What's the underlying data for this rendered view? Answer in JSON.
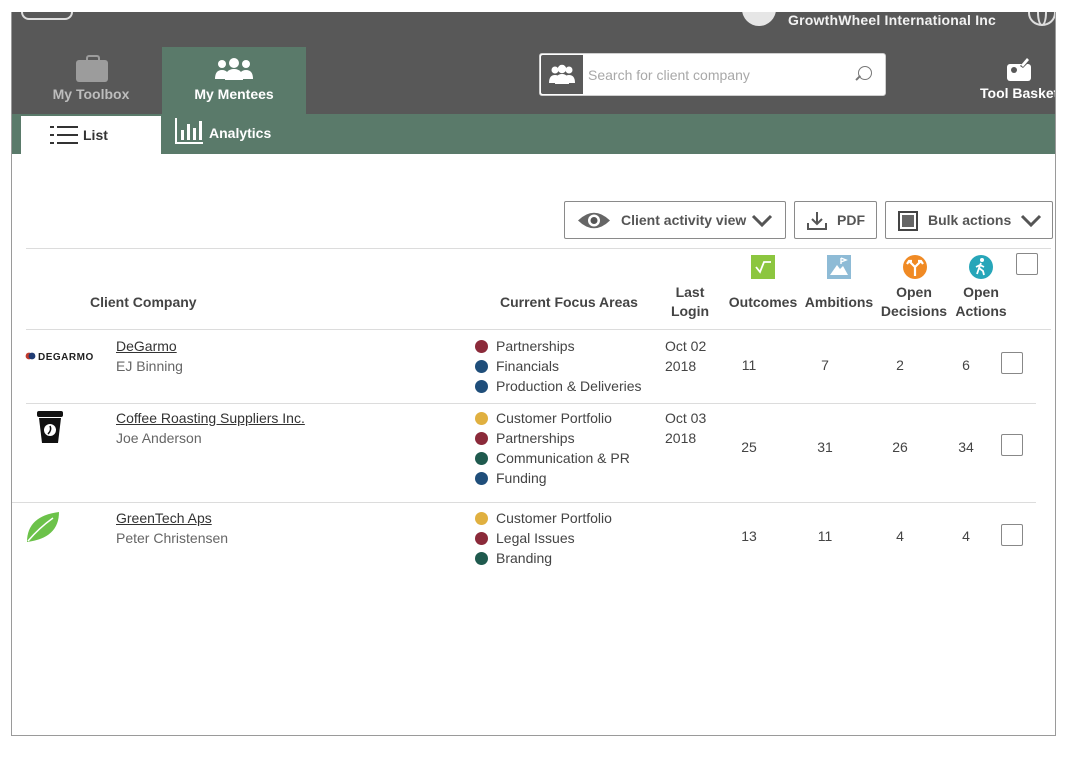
{
  "header": {
    "org_name": "GrowthWheel International Inc",
    "nav": [
      {
        "label": "My Toolbox",
        "icon": "toolbox-icon",
        "active": false
      },
      {
        "label": "My Mentees",
        "icon": "mentees-icon",
        "active": true
      }
    ],
    "search": {
      "placeholder": "Search for client company",
      "value": ""
    },
    "tool_basket_label": "Tool Basket"
  },
  "subnav": {
    "tabs": [
      {
        "label": "List",
        "icon": "list-icon",
        "active": true
      },
      {
        "label": "Analytics",
        "icon": "chart-icon",
        "active": false
      }
    ]
  },
  "toolbar": {
    "activity_view_label": "Client activity view",
    "pdf_label": "PDF",
    "bulk_actions_label": "Bulk actions"
  },
  "table": {
    "columns": {
      "company": "Client Company",
      "focus": "Current Focus Areas",
      "last_login": [
        "Last",
        "Login"
      ],
      "outcomes": "Outcomes",
      "ambitions": "Ambitions",
      "open_decisions": [
        "Open",
        "Decisions"
      ],
      "open_actions": [
        "Open",
        "Actions"
      ]
    },
    "rows": [
      {
        "logo_text": "DEGARMO",
        "company": "DeGarmo",
        "person": "EJ Binning",
        "focus": [
          {
            "label": "Partnerships",
            "color": "#8b2a3a"
          },
          {
            "label": "Financials",
            "color": "#1f4e7a"
          },
          {
            "label": "Production & Deliveries",
            "color": "#1f4e7a"
          }
        ],
        "last_login": [
          "Oct 02",
          "2018"
        ],
        "outcomes": "11",
        "ambitions": "7",
        "open_decisions": "2",
        "open_actions": "6"
      },
      {
        "logo_text": "",
        "company": "Coffee Roasting Suppliers Inc.",
        "person": "Joe Anderson",
        "focus": [
          {
            "label": "Customer Portfolio",
            "color": "#e0b040"
          },
          {
            "label": "Partnerships",
            "color": "#8b2a3a"
          },
          {
            "label": "Communication & PR",
            "color": "#1f5a4e"
          },
          {
            "label": "Funding",
            "color": "#1f4e7a"
          }
        ],
        "last_login": [
          "Oct 03",
          "2018"
        ],
        "outcomes": "25",
        "ambitions": "31",
        "open_decisions": "26",
        "open_actions": "34"
      },
      {
        "logo_text": "",
        "company": "GreenTech Aps",
        "person": "Peter Christensen",
        "focus": [
          {
            "label": "Customer Portfolio",
            "color": "#e0b040"
          },
          {
            "label": "Legal Issues",
            "color": "#8b2a3a"
          },
          {
            "label": "Branding",
            "color": "#1f5a4e"
          }
        ],
        "last_login": [
          "",
          ""
        ],
        "outcomes": "13",
        "ambitions": "11",
        "open_decisions": "4",
        "open_actions": "4"
      }
    ]
  },
  "colors": {
    "topbar": "#585858",
    "accent": "#5a7a6a",
    "outcomes_icon": "#8cc63f",
    "ambitions_icon": "#8ebbd6",
    "decisions_icon": "#f08a24",
    "actions_icon": "#27a6b9"
  }
}
